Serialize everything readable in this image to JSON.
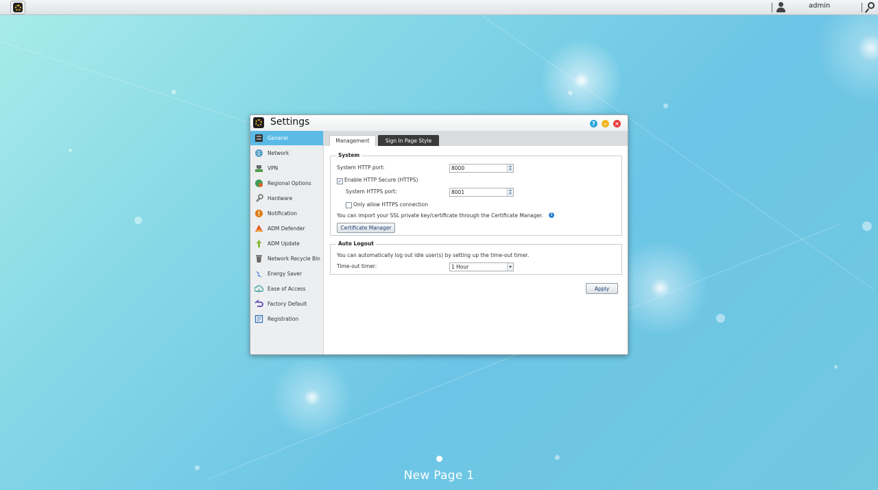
{
  "topbar": {
    "user": "admin"
  },
  "window": {
    "title": "Settings"
  },
  "sidebar": {
    "items": [
      {
        "label": "General",
        "icon": "general-icon",
        "active": true
      },
      {
        "label": "Network",
        "icon": "network-icon"
      },
      {
        "label": "VPN",
        "icon": "vpn-icon"
      },
      {
        "label": "Regional Options",
        "icon": "regional-options-icon"
      },
      {
        "label": "Hardware",
        "icon": "hardware-icon"
      },
      {
        "label": "Notification",
        "icon": "notification-icon"
      },
      {
        "label": "ADM Defender",
        "icon": "adm-defender-icon"
      },
      {
        "label": "ADM Update",
        "icon": "adm-update-icon"
      },
      {
        "label": "Network Recycle Bin",
        "icon": "recycle-bin-icon"
      },
      {
        "label": "Energy Saver",
        "icon": "energy-saver-icon"
      },
      {
        "label": "Ease of Access",
        "icon": "ease-of-access-icon"
      },
      {
        "label": "Factory Default",
        "icon": "factory-default-icon"
      },
      {
        "label": "Registration",
        "icon": "registration-icon"
      }
    ]
  },
  "tabs": [
    {
      "label": "Management",
      "active": true
    },
    {
      "label": "Sign In Page Style",
      "active": false
    }
  ],
  "system": {
    "legend": "System",
    "http_port_label": "System HTTP port:",
    "http_port_value": "8000",
    "https_enable_label": "Enable HTTP Secure (HTTPS)",
    "https_enabled": true,
    "https_port_label": "System HTTPS port:",
    "https_port_value": "8001",
    "https_only_label": "Only allow HTTPS connection",
    "https_only": false,
    "ssl_note": "You can import your SSL private key/certificate through the Certificate Manager.",
    "cert_button": "Certificate Manager"
  },
  "auto_logout": {
    "legend": "Auto Logout",
    "note": "You can automatically log out idle user(s) by setting up the time-out timer.",
    "timer_label": "Time-out timer:",
    "timer_value": "1 Hour"
  },
  "apply_label": "Apply",
  "desktop": {
    "page_label": "New Page 1"
  },
  "colors": {
    "accent": "#5bbbe6",
    "tab_dark": "#3a3a3a",
    "close": "#e8383a",
    "minimize": "#f2b626",
    "help": "#2aa6d9"
  }
}
